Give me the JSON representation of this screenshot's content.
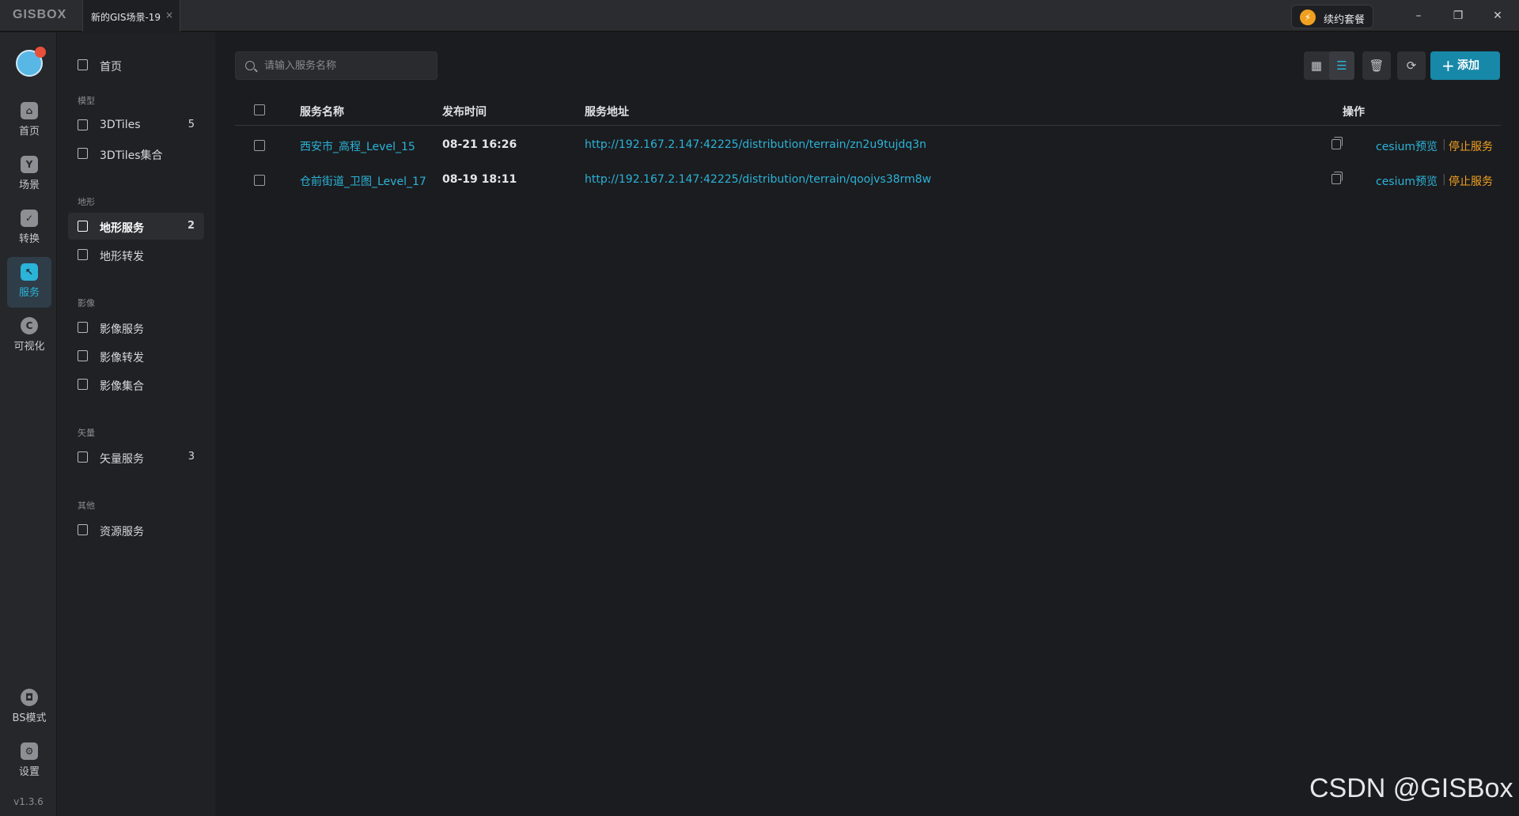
{
  "titlebar": {
    "logo": "GISBOX",
    "tab_title": "新的GIS场景-19",
    "tab_close": "×",
    "renew_label": "续约套餐",
    "renew_icon": "bolt-icon",
    "minimize": "–",
    "maximize": "❐",
    "close": "✕"
  },
  "rail": {
    "items": [
      {
        "label": "首页",
        "icon": "home-icon"
      },
      {
        "label": "场景",
        "icon": "scene-icon"
      },
      {
        "label": "转换",
        "icon": "convert-icon"
      },
      {
        "label": "服务",
        "icon": "service-icon"
      },
      {
        "label": "可视化",
        "icon": "visualize-icon"
      },
      {
        "label": "BS模式",
        "icon": "lock-icon"
      },
      {
        "label": "设置",
        "icon": "settings-icon"
      }
    ],
    "version": "v1.3.6"
  },
  "sidebar": {
    "home": "首页",
    "sections": {
      "model": "模型",
      "terrain": "地形",
      "imagery": "影像",
      "vector": "矢量",
      "other": "其他"
    },
    "items": {
      "tiles3d": {
        "label": "3DTiles",
        "count": "5"
      },
      "tiles3d_set": {
        "label": "3DTiles集合"
      },
      "terrain_service": {
        "label": "地形服务",
        "count": "2"
      },
      "terrain_forward": {
        "label": "地形转发"
      },
      "image_service": {
        "label": "影像服务"
      },
      "image_forward": {
        "label": "影像转发"
      },
      "image_set": {
        "label": "影像集合"
      },
      "vector_service": {
        "label": "矢量服务",
        "count": "3"
      },
      "resource_service": {
        "label": "资源服务"
      }
    }
  },
  "main": {
    "search_placeholder": "请输入服务名称",
    "add_label": "添加",
    "columns": {
      "name": "服务名称",
      "time": "发布时间",
      "address": "服务地址",
      "actions": "操作"
    },
    "rows": [
      {
        "name": "西安市_高程_Level_15",
        "time": "08-21 16:26",
        "url": "http://192.167.2.147:42225/distribution/terrain/zn2u9tujdq3n",
        "preview": "cesium预览",
        "stop": "停止服务"
      },
      {
        "name": "仓前街道_卫图_Level_17",
        "time": "08-19 18:11",
        "url": "http://192.167.2.147:42225/distribution/terrain/qoojvs38rm8w",
        "preview": "cesium预览",
        "stop": "停止服务"
      }
    ]
  },
  "watermark": "CSDN @GISBox",
  "colors": {
    "accent": "#2bb3d8",
    "warning": "#f0a020",
    "primary_button": "#1788a8"
  }
}
